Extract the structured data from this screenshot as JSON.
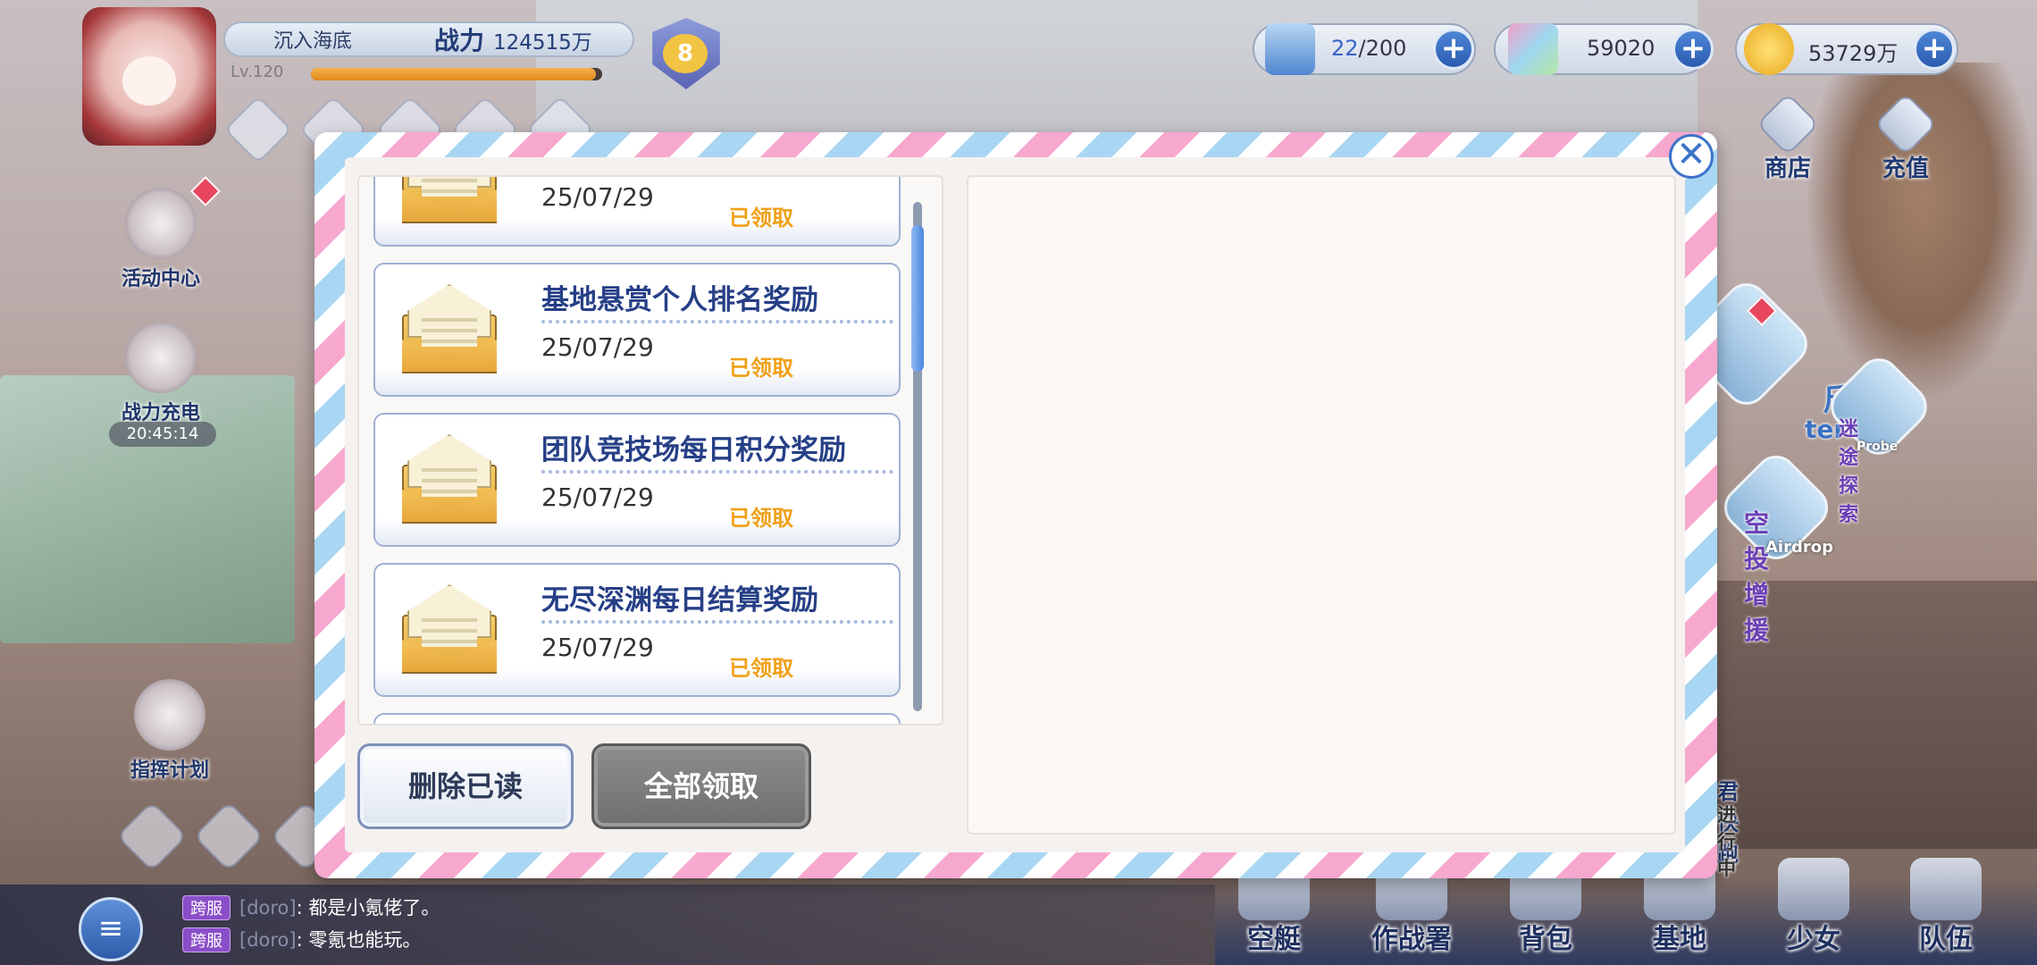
{
  "player": {
    "name": "沉入海底",
    "power_label": "战力",
    "power_value": "124515万",
    "level": "Lv.120",
    "xp_fraction": 0.98,
    "rank": "8"
  },
  "resources": [
    {
      "icon": "stamina-icon",
      "current": "22",
      "max": "/200"
    },
    {
      "icon": "crystal-icon",
      "value": "59020"
    },
    {
      "icon": "coin-icon",
      "value": "53729万"
    }
  ],
  "top_right": {
    "shop_label": "商店",
    "recharge_label": "充值"
  },
  "left_side": {
    "activity_label": "活动中心",
    "power_charge_label": "战力充电",
    "power_charge_timer": "20:45:14",
    "command_plan_label": "指挥计划"
  },
  "right_side": {
    "probe_title": "迷途探索",
    "probe_sub": "Probe",
    "airdrop_title": "空投增援",
    "airdrop_sub": "Airdrop",
    "run_title": "君快跑",
    "run_status": "进行中",
    "center_title": "斤",
    "center_sub": "ter"
  },
  "bottom_nav": [
    {
      "label": "空艇"
    },
    {
      "label": "作战署"
    },
    {
      "label": "背包"
    },
    {
      "label": "基地"
    },
    {
      "label": "少女"
    },
    {
      "label": "队伍"
    }
  ],
  "chat": [
    {
      "tag": "跨服",
      "user": "[doro]",
      "text": ": 都是小氪佬了。"
    },
    {
      "tag": "跨服",
      "user": "[doro]",
      "text": ": 零氪也能玩。"
    }
  ],
  "mail": {
    "items": [
      {
        "title": "",
        "date": "25/07/29",
        "status": "已领取"
      },
      {
        "title": "基地悬赏个人排名奖励",
        "date": "25/07/29",
        "status": "已领取"
      },
      {
        "title": "团队竞技场每日积分奖励",
        "date": "25/07/29",
        "status": "已领取"
      },
      {
        "title": "无尽深渊每日结算奖励",
        "date": "25/07/29",
        "status": "已领取"
      }
    ],
    "delete_read_label": "删除已读",
    "claim_all_label": "全部领取",
    "close_symbol": "✕"
  },
  "colors": {
    "accent_blue": "#263f86",
    "claimed_orange": "#f0a018",
    "stripe_pink": "#f7a8cf",
    "stripe_blue": "#a8d6f3"
  }
}
